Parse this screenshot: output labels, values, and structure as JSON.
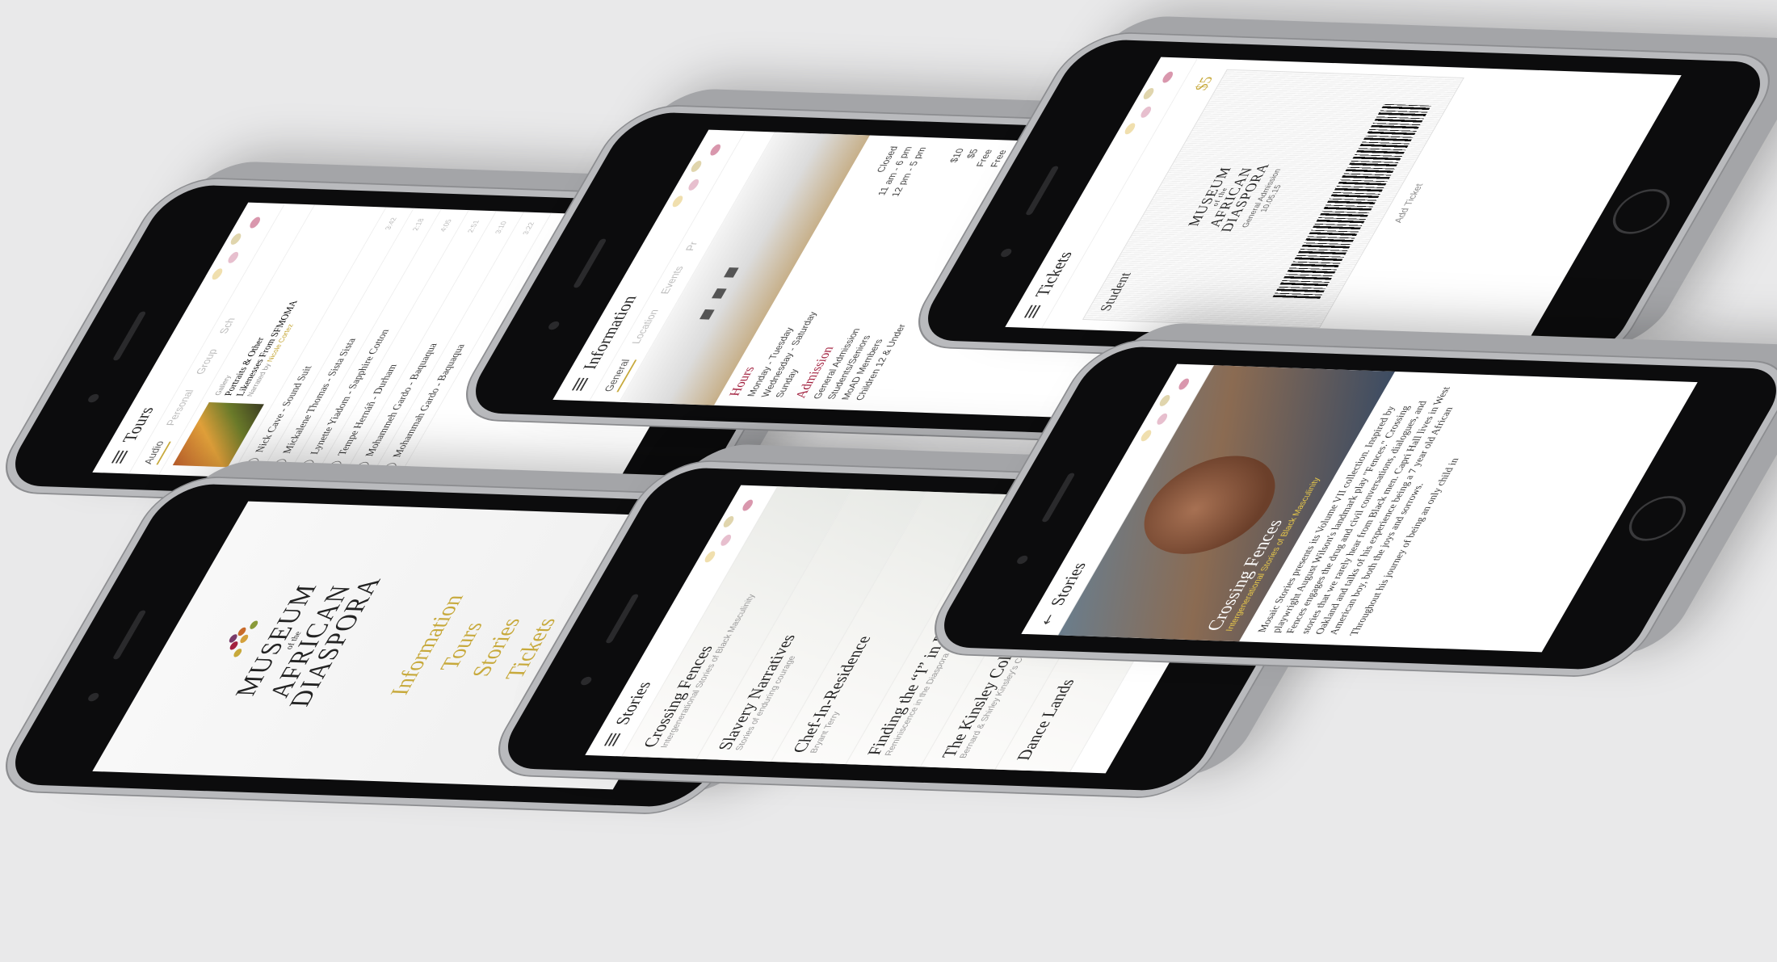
{
  "tours": {
    "title": "Tours",
    "tabs": [
      "Audio",
      "Personal",
      "Group",
      "Sch"
    ],
    "feature": {
      "small": "Gallery",
      "title_line1": "Portraits & Other",
      "title_line2": "Likenesses From SFMOMA",
      "narrated": "Narrated by",
      "narrator": "Nicole Cortez"
    },
    "tracks": [
      {
        "label": "Nick Cave - Sound Suit",
        "dur": "3:42"
      },
      {
        "label": "Mickalene Thomas - Sista Sista",
        "dur": "2:18"
      },
      {
        "label": "Lynette Yiadom - Sapphire Cotton",
        "dur": "4:05"
      },
      {
        "label": "Tempe Hernáñ - Durham",
        "dur": "2:51"
      },
      {
        "label": "Mohammeh Gardo - Baquaqua",
        "dur": "3:10"
      },
      {
        "label": "Mohammah Gardo - Baquaqua",
        "dur": "3:22"
      }
    ]
  },
  "info": {
    "title": "Information",
    "tabs": [
      "General",
      "Location",
      "Events",
      "Pr"
    ],
    "hours_title": "Hours",
    "hours": [
      {
        "day": "Monday - Tuesday",
        "time": "Closed"
      },
      {
        "day": "Wednesday - Saturday",
        "time": "11 am - 6 pm"
      },
      {
        "day": "Sunday",
        "time": "12 pm - 5 pm"
      }
    ],
    "admission_title": "Admission",
    "admission": [
      {
        "type": "General Admission",
        "price": "$10"
      },
      {
        "type": "Students/Seniors",
        "price": "$5"
      },
      {
        "type": "MoAD Members",
        "price": "Free"
      },
      {
        "type": "Children 12 & Under",
        "price": "Free"
      }
    ]
  },
  "tickets": {
    "title": "Tickets",
    "label": "Student",
    "price": "$5",
    "logo_line1": "MUSEUM",
    "logo_of": "of the",
    "logo_line2": "AFRICAN",
    "logo_line3": "DIASPORA",
    "admission": "General Admission",
    "date": "10.05.15",
    "add": "Add Ticket"
  },
  "home": {
    "logo_line1": "MUSEUM",
    "logo_of": "of the",
    "logo_line2": "AFRICAN",
    "logo_line3": "DIASPORA",
    "links": [
      "Information",
      "Tours",
      "Stories",
      "Tickets"
    ]
  },
  "stories_list": {
    "title": "Stories",
    "items": [
      {
        "h": "Crossing Fences",
        "s": "Intergenerational Stories of Black Masculinity"
      },
      {
        "h": "Slavery Narratives",
        "s": "Stories of enduring courage"
      },
      {
        "h": "Chef-In-Residence",
        "s": "Bryant Terry"
      },
      {
        "h": "Finding the “I” in Diaspora",
        "s": "Reminiscence in the Diaspora"
      },
      {
        "h": "The Kinsley Collection",
        "s": "Bernard & Shirley Kinsley's Collection"
      },
      {
        "h": "Dance Lands",
        "s": ""
      }
    ]
  },
  "story_detail": {
    "title": "Stories",
    "hero_title": "Crossing Fences",
    "hero_sub": "Intergenerational Stories of Black Masculinity",
    "p1": "Mosaic Stories presents its Volume VII collection. Inspired by playwright August Wilson's landmark play \"Fences.\" Crossing Fences engages the drug and civil conversations, dialogues, and stories that we rarely hear from Black men. Capri Hall lives in West Oakland and talks of his experience being a 7 year old African American boy, both the joys and sorrows.",
    "p2": "Throughout his journey of being an only child in"
  },
  "colors": {
    "accent": "#c7a93b",
    "crimson": "#a3213f",
    "background": "#e9e9ea"
  }
}
